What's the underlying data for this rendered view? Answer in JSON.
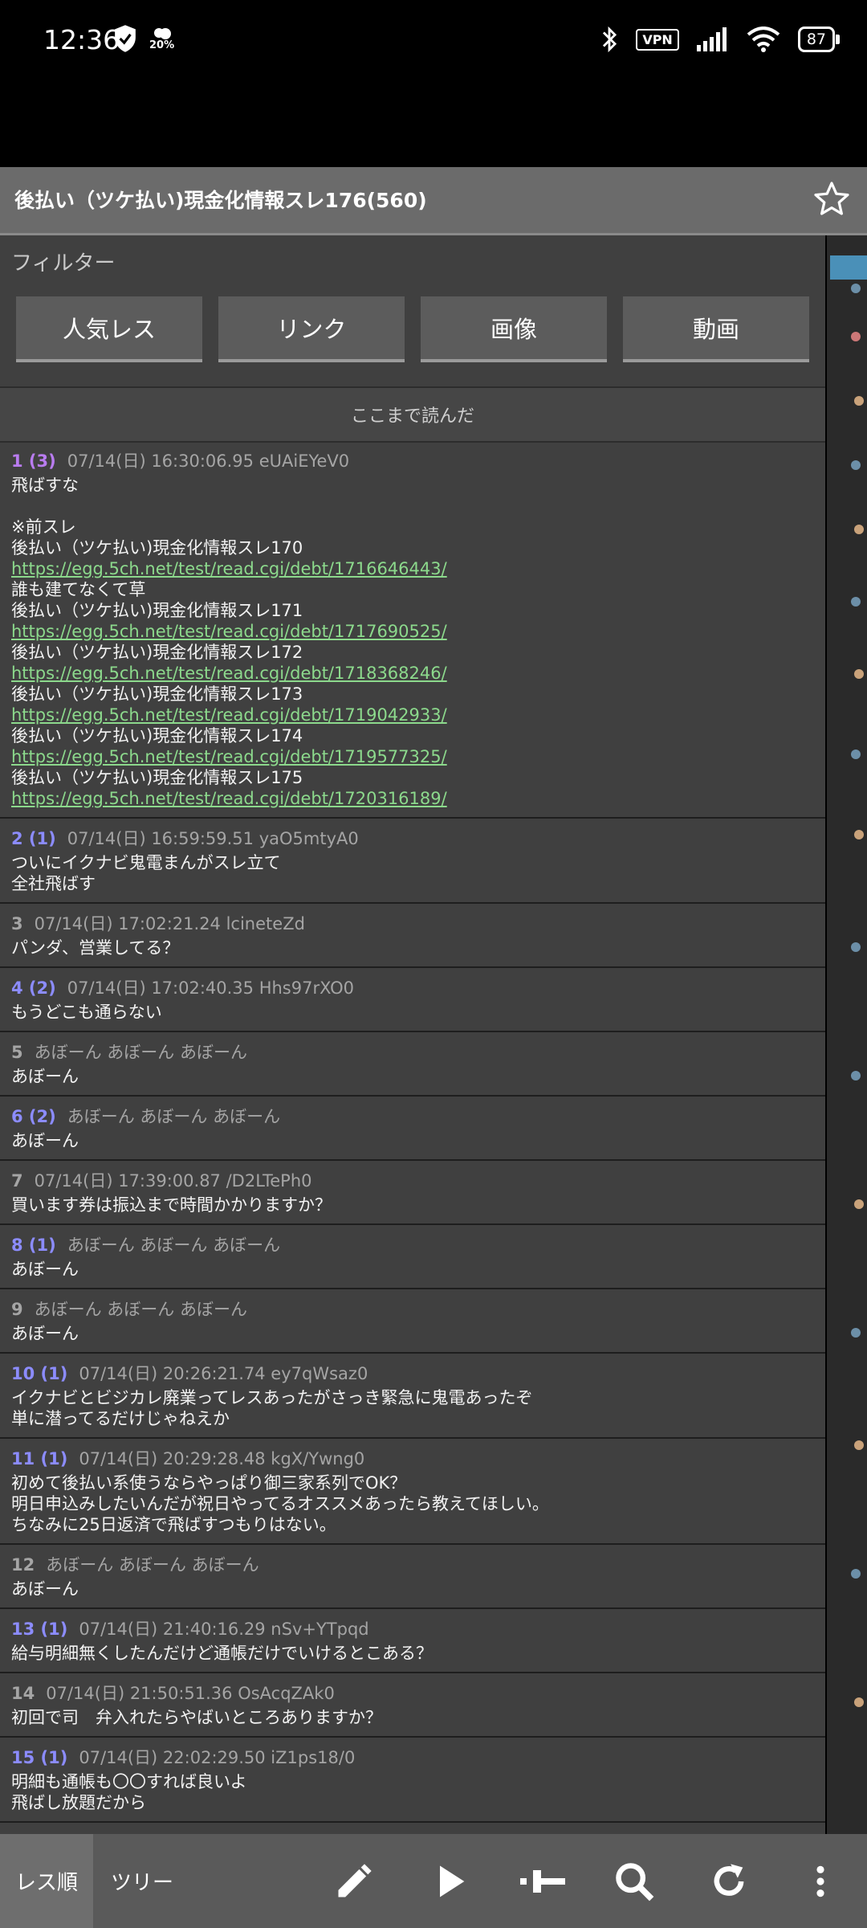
{
  "status": {
    "time": "12:36",
    "weather_temp": "20%",
    "vpn": "VPN",
    "battery": "87"
  },
  "thread": {
    "title": "後払い（ツケ払い)現金化情報スレ176(560)"
  },
  "filter": {
    "label": "フィルター",
    "buttons": [
      "人気レス",
      "リンク",
      "画像",
      "動画"
    ]
  },
  "read_marker": "ここまで読んだ",
  "posts": [
    {
      "num": "1 (3)",
      "meta": "07/14(日) 16:30:06.95 eUAiEYeV0",
      "lines": [
        "飛ばすな",
        "",
        "※前スレ",
        "後払い（ツケ払い)現金化情報スレ170"
      ],
      "extra": [
        {
          "link": "https://egg.5ch.net/test/read.cgi/debt/1716646443/"
        },
        {
          "text": "誰も建てなくて草"
        },
        {
          "text": "後払い（ツケ払い)現金化情報スレ171"
        },
        {
          "link": "https://egg.5ch.net/test/read.cgi/debt/1717690525/"
        },
        {
          "text": "後払い（ツケ払い)現金化情報スレ172"
        },
        {
          "link": "https://egg.5ch.net/test/read.cgi/debt/1718368246/"
        },
        {
          "text": "後払い（ツケ払い)現金化情報スレ173"
        },
        {
          "link": "https://egg.5ch.net/test/read.cgi/debt/1719042933/"
        },
        {
          "text": "後払い（ツケ払い)現金化情報スレ174"
        },
        {
          "link": "https://egg.5ch.net/test/read.cgi/debt/1719577325/"
        },
        {
          "text": "後払い（ツケ払い)現金化情報スレ175"
        },
        {
          "link": "https://egg.5ch.net/test/read.cgi/debt/1720316189/"
        }
      ]
    },
    {
      "num": "2 (1)",
      "meta": "07/14(日) 16:59:59.51 yaO5mtyA0",
      "body": "ついにイクナビ鬼電まんがスレ立て\n全社飛ばす"
    },
    {
      "num": "3",
      "meta": "07/14(日) 17:02:21.24 lcineteZd",
      "body": "パンダ、営業してる？"
    },
    {
      "num": "4 (2)",
      "meta": "07/14(日) 17:02:40.35 Hhs97rXO0",
      "body": "もうどこも通らない"
    },
    {
      "num": "5",
      "meta": "あぼーん あぼーん あぼーん",
      "body": "あぼーん"
    },
    {
      "num": "6 (2)",
      "meta": "あぼーん あぼーん あぼーん",
      "body": "あぼーん"
    },
    {
      "num": "7",
      "meta": "07/14(日) 17:39:00.87 /D2LTePh0",
      "body": "買います券は振込まで時間かかりますか？"
    },
    {
      "num": "8 (1)",
      "meta": "あぼーん あぼーん あぼーん",
      "body": "あぼーん"
    },
    {
      "num": "9",
      "meta": "あぼーん あぼーん あぼーん",
      "body": "あぼーん"
    },
    {
      "num": "10 (1)",
      "meta": "07/14(日) 20:26:21.74 ey7qWsaz0",
      "body": "イクナビとビジカレ廃業ってレスあったがさっき緊急に鬼電あったぞ\n単に潜ってるだけじゃねえか"
    },
    {
      "num": "11 (1)",
      "meta": "07/14(日) 20:29:28.48 kgX/Ywng0",
      "body": "初めて後払い系使うならやっぱり御三家系列でOK？\n明日申込みしたいんだが祝日やってるオススメあったら教えてほしい。\nちなみに25日返済で飛ばすつもりはない。"
    },
    {
      "num": "12",
      "meta": "あぼーん あぼーん あぼーん",
      "body": "あぼーん"
    },
    {
      "num": "13 (1)",
      "meta": "07/14(日) 21:40:16.29 nSv+YTpqd",
      "body": "給与明細無くしたんだけど通帳だけでいけるとこある？"
    },
    {
      "num": "14",
      "meta": "07/14(日) 21:50:51.36 OsAcqZAk0",
      "body": "初回で司　弁入れたらやばいところありますか？"
    },
    {
      "num": "15 (1)",
      "meta": "07/14(日) 22:02:29.50 iZ1ps18/0",
      "body": "明細も通帳も〇〇すれば良いよ\n飛ばし放題だから"
    }
  ],
  "bottom": {
    "tab_order": "レス順",
    "tab_tree": "ツリー"
  }
}
